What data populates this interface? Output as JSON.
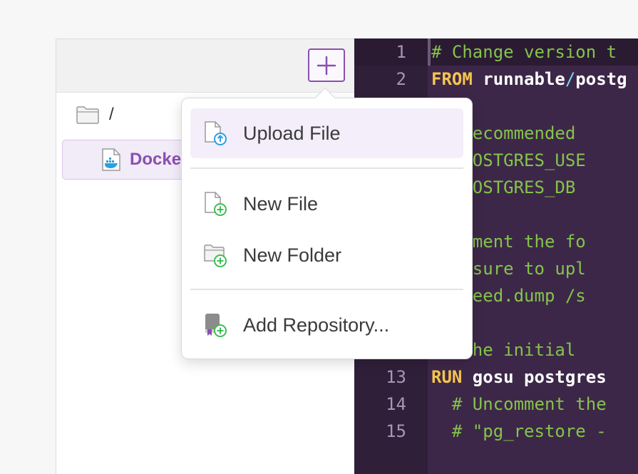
{
  "explorer": {
    "add_button_icon": "plus-icon",
    "root": {
      "icon": "folder-icon",
      "label": "/"
    },
    "files": [
      {
        "icon": "dockerfile-icon",
        "label": "Dockerfile",
        "selected": true
      }
    ]
  },
  "editor": {
    "lines": [
      {
        "num": "1",
        "tokens": [
          {
            "t": "comment",
            "v": "# Change version t"
          }
        ]
      },
      {
        "num": "2",
        "tokens": [
          {
            "t": "kw",
            "v": "FROM "
          },
          {
            "t": "plain",
            "v": "runnable"
          },
          {
            "t": "slash",
            "v": "/"
          },
          {
            "t": "plain",
            "v": "postg"
          }
        ]
      },
      {
        "num": "",
        "tokens": []
      },
      {
        "num": "",
        "tokens": [
          {
            "t": "comment",
            "v": "et recommended"
          }
        ]
      },
      {
        "num": "",
        "tokens": [
          {
            "t": "comment",
            "v": "NV POSTGRES_USE"
          }
        ]
      },
      {
        "num": "",
        "tokens": [
          {
            "t": "comment",
            "v": "NV POSTGRES_DB"
          }
        ]
      },
      {
        "num": "",
        "tokens": []
      },
      {
        "num": "",
        "tokens": [
          {
            "t": "comment",
            "v": "ncomment the fo"
          }
        ]
      },
      {
        "num": "",
        "tokens": [
          {
            "t": "comment",
            "v": "ake sure to upl"
          }
        ]
      },
      {
        "num": "",
        "tokens": [
          {
            "t": "comment",
            "v": "DD seed.dump /s"
          }
        ]
      },
      {
        "num": "",
        "tokens": []
      },
      {
        "num": "",
        "tokens": [
          {
            "t": "comment",
            "v": "un the initial"
          }
        ]
      },
      {
        "num": "13",
        "tokens": [
          {
            "t": "kw",
            "v": "RUN "
          },
          {
            "t": "plain",
            "v": "gosu postgres"
          }
        ]
      },
      {
        "num": "14",
        "tokens": [
          {
            "t": "comment",
            "v": "  # Uncomment the"
          }
        ]
      },
      {
        "num": "15",
        "tokens": [
          {
            "t": "comment",
            "v": "  # \"pg_restore -"
          }
        ]
      }
    ]
  },
  "menu": {
    "items": [
      {
        "label": "Upload File",
        "icon": "upload-file-icon",
        "highlighted": true
      },
      {
        "label": "New File",
        "icon": "new-file-icon",
        "highlighted": false
      },
      {
        "label": "New Folder",
        "icon": "new-folder-icon",
        "highlighted": false
      },
      {
        "label": "Add Repository...",
        "icon": "add-repository-icon",
        "highlighted": false
      }
    ]
  },
  "colors": {
    "accent": "#8a4fb0",
    "editor_bg": "#3d2748",
    "comment": "#84c44a",
    "keyword": "#f5c54d",
    "add_green": "#3dbe55",
    "upload_blue": "#2d9fe0"
  }
}
